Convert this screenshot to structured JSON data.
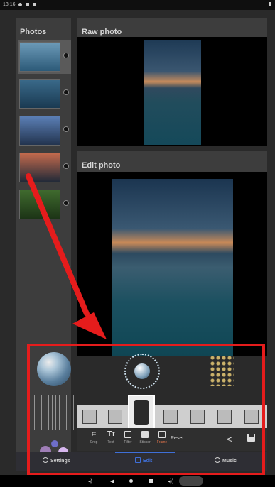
{
  "status": {
    "time": "18:16"
  },
  "panels": {
    "photos_title": "Photos",
    "raw_title": "Raw photo",
    "edit_title": "Edit photo"
  },
  "thumbnails": [
    {
      "label": "photo-1",
      "colors": [
        "#6c9ab8",
        "#2c5a78"
      ]
    },
    {
      "label": "photo-2",
      "colors": [
        "#3a6a8a",
        "#1a3a52"
      ]
    },
    {
      "label": "photo-3",
      "colors": [
        "#5b7fb5",
        "#23344f"
      ]
    },
    {
      "label": "photo-4",
      "colors": [
        "#c36a4d",
        "#222a38"
      ]
    },
    {
      "label": "photo-5",
      "colors": [
        "#3f6a2e",
        "#1c3416"
      ]
    }
  ],
  "toolbar": {
    "crop": "Crop",
    "text": "Text",
    "filter": "Filter",
    "sticker": "Sticker",
    "frame": "Frame",
    "reset": "Reset"
  },
  "bottom_tabs": {
    "settings": "Settings",
    "edit": "Edit",
    "music": "Music"
  },
  "colors": {
    "highlight_box": "#e51c1c",
    "arrow": "#e51c1c",
    "active_tab": "#3f6fd8",
    "active_tool": "#e0734a"
  }
}
